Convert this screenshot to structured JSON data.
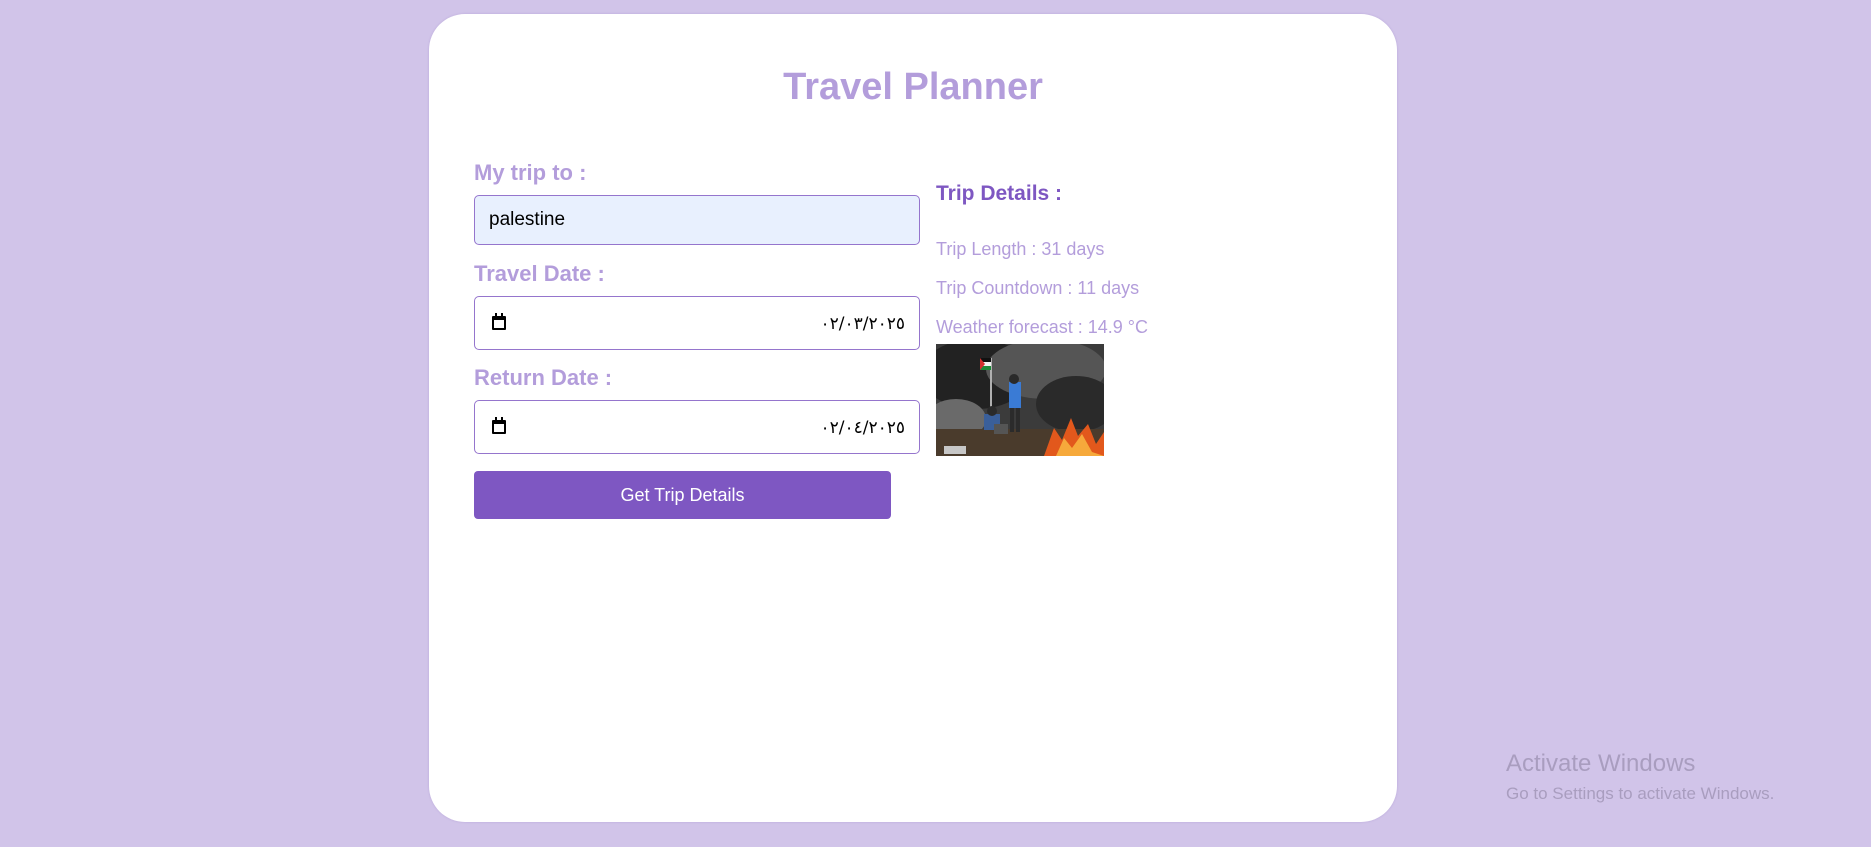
{
  "header": {
    "title": "Travel Planner"
  },
  "form": {
    "destination_label": "My trip to :",
    "destination_value": "palestine",
    "travel_date_label": "Travel Date :",
    "travel_date_value": "٠٢/٠٣/٢٠٢٥",
    "return_date_label": "Return Date :",
    "return_date_value": "٠٢/٠٤/٢٠٢٥",
    "submit_label": "Get Trip Details"
  },
  "details": {
    "heading": "Trip Details :",
    "trip_length": "Trip Length : 31 days",
    "trip_countdown": "Trip Countdown : 11 days",
    "weather": "Weather forecast : 14.9 °C"
  },
  "watermark": {
    "title": "Activate Windows",
    "subtitle": "Go to Settings to activate Windows."
  },
  "colors": {
    "background": "#d1c4e9",
    "accent": "#7e57c2",
    "label": "#b39ddb"
  }
}
